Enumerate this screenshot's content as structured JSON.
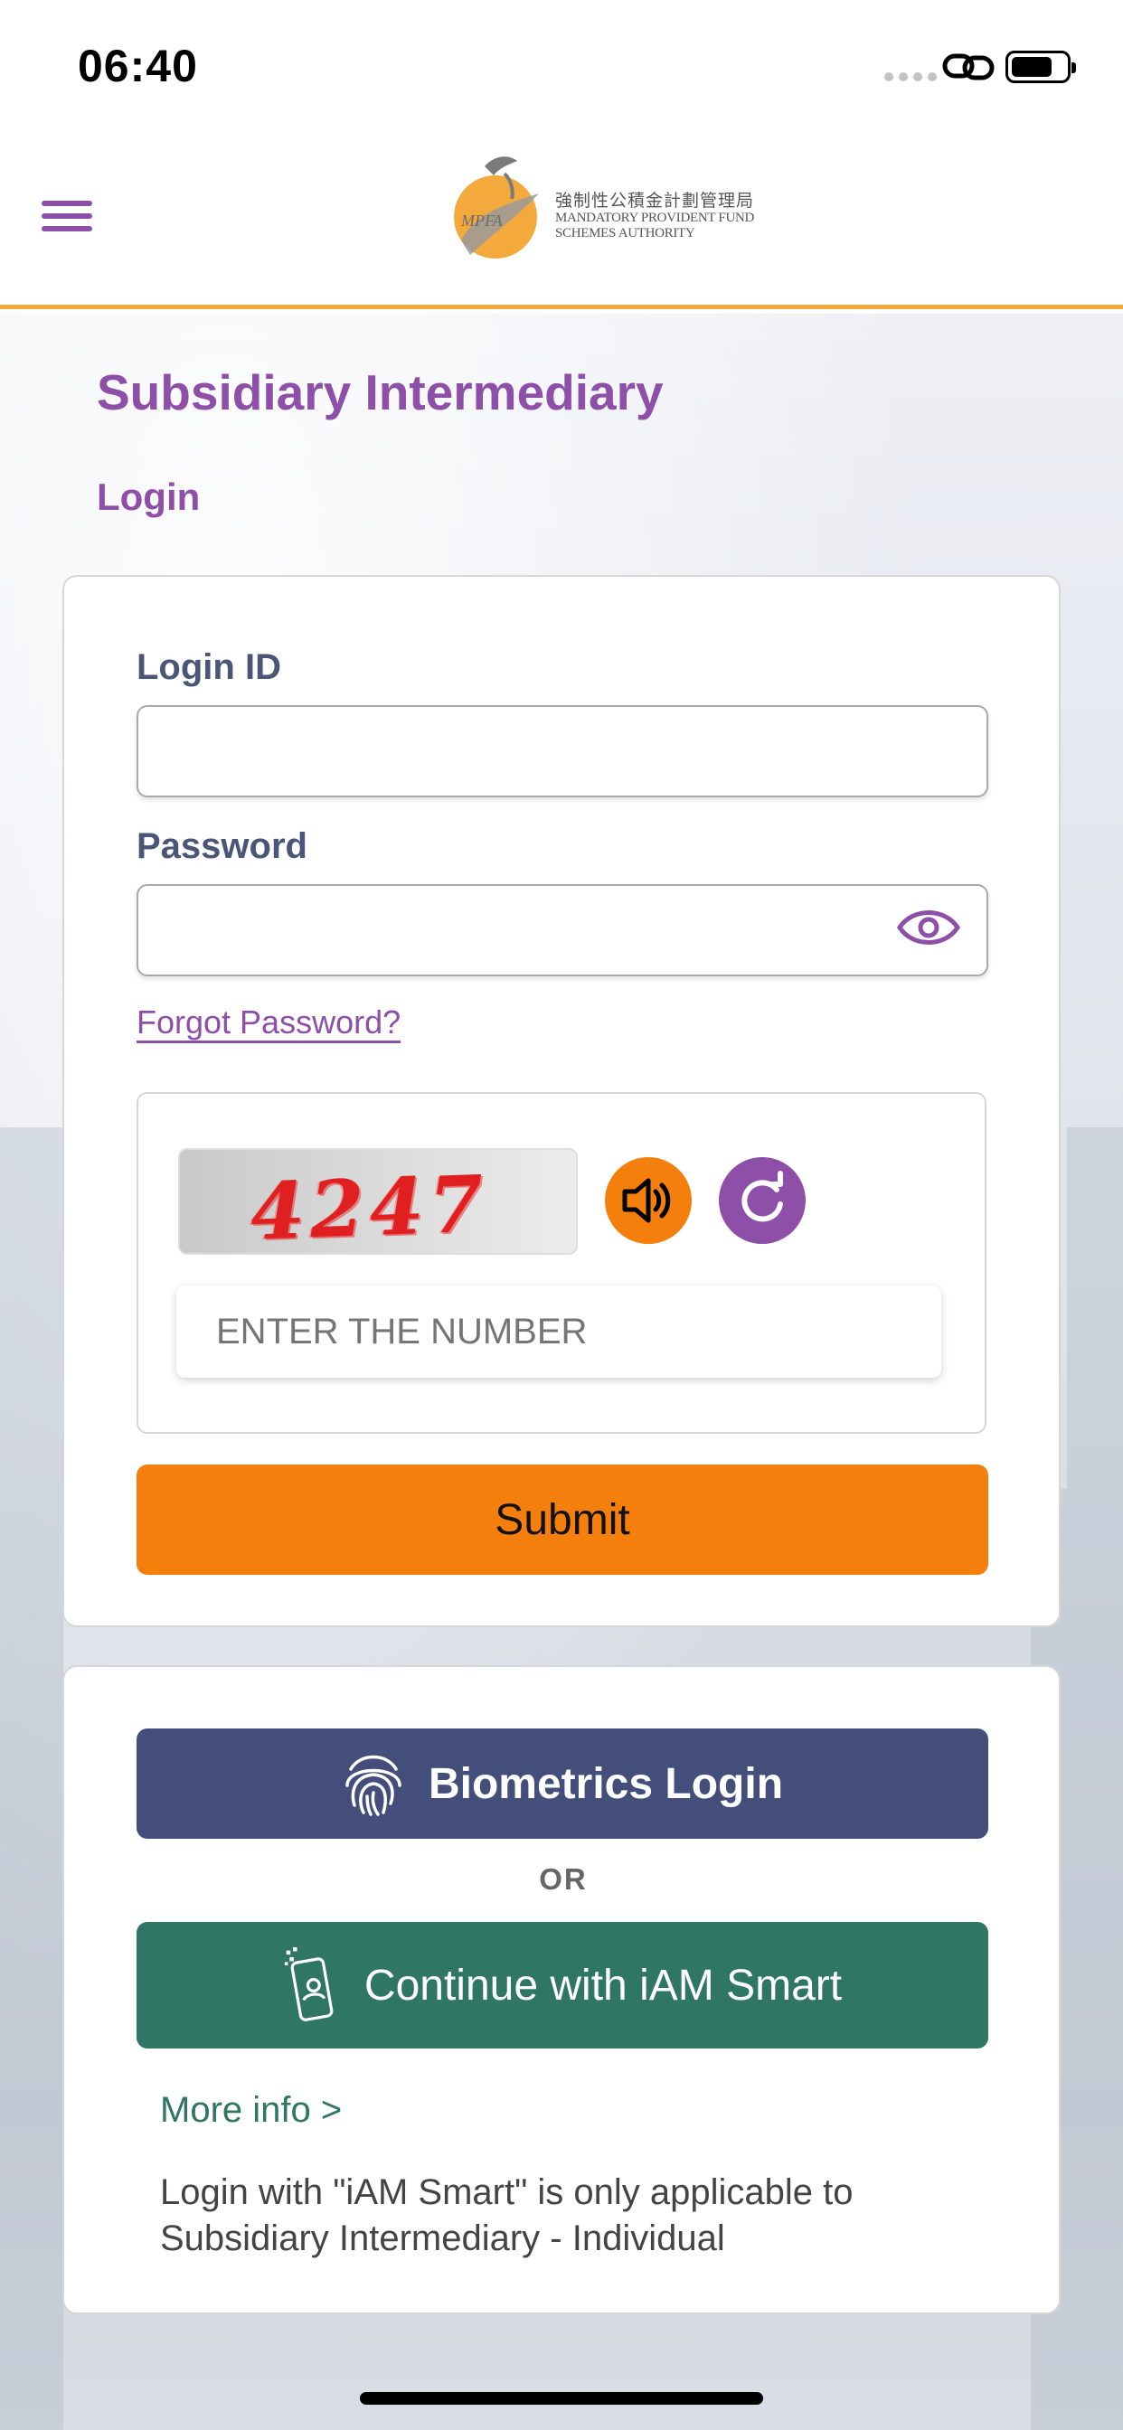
{
  "status_bar": {
    "time": "06:40"
  },
  "header": {
    "logo": {
      "cn_text": "強制性公積金計劃管理局",
      "en_line1": "MANDATORY PROVIDENT FUND",
      "en_line2": "SCHEMES AUTHORITY",
      "mark_text": "MPFA"
    }
  },
  "page": {
    "title": "Subsidiary Intermediary",
    "subtitle": "Login"
  },
  "login_form": {
    "login_id_label": "Login ID",
    "login_id_value": "",
    "password_label": "Password",
    "password_value": "",
    "forgot_password": "Forgot Password?",
    "captcha": {
      "image_text": "4247",
      "input_placeholder": "ENTER THE NUMBER",
      "input_value": ""
    },
    "submit_label": "Submit"
  },
  "alt_login": {
    "biometrics_label": "Biometrics Login",
    "or_text": "OR",
    "iam_smart_label": "Continue with iAM Smart",
    "more_info": "More info >",
    "note": "Login with \"iAM Smart\" is only applicable to Subsidiary Intermediary - Individual"
  },
  "colors": {
    "brand_purple": "#8e4fa8",
    "accent_orange": "#f57f0c",
    "biometrics_blue": "#434f7a",
    "iam_green": "#2f7665",
    "header_line": "#f0a93a"
  },
  "icons": {
    "menu": "hamburger-menu-icon",
    "eye": "eye-icon",
    "audio": "speaker-icon",
    "refresh": "refresh-icon",
    "fingerprint": "fingerprint-icon",
    "iam_smart": "phone-person-icon"
  }
}
